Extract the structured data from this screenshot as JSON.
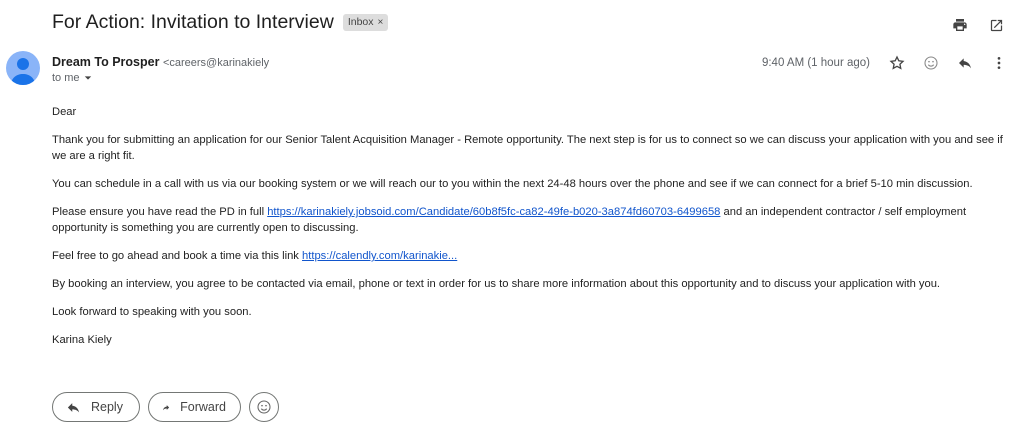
{
  "email": {
    "subject": "For Action: Invitation to Interview",
    "label": "Inbox",
    "label_close": "×",
    "sender_name": "Dream To Prosper",
    "sender_email": "<careers@karinakiely",
    "to_line": "to me",
    "time": "9:40 AM (1 hour ago)"
  },
  "icons": {
    "print": "print-icon",
    "open_new": "open-in-new-window-icon",
    "star": "star-icon",
    "emoji": "emoji-icon",
    "reply": "reply-icon",
    "more": "more-vert-icon"
  },
  "body": {
    "greeting": "Dear",
    "p1": "Thank you for submitting an application for our Senior Talent Acquisition Manager - Remote opportunity. The next step is for us to connect so we can discuss your application with you and see if we are a right fit.",
    "p2": "You can schedule in a call with us via our booking system or we will reach our to you within the next 24-48 hours over the phone and see if we can connect for a brief 5-10 min discussion.",
    "p3_before": "Please ensure you have read the PD in full ",
    "p3_link": "https://karinakiely.jobsoid.com/Candidate/60b8f5fc-ca82-49fe-b020-3a874fd60703-6499658",
    "p3_after": " and an independent contractor / self employment opportunity is something you are currently open to discussing.",
    "p4_before": "Feel free to go ahead and book a time via this link ",
    "p4_link": "https://calendly.com/karinakie...",
    "p5": "By booking an interview, you agree to be contacted via email, phone or text in order for us to share more information about this opportunity and to discuss your application with you.",
    "p6": "Look forward to speaking with you soon.",
    "signature": "Karina Kiely"
  },
  "actions": {
    "reply_label": "Reply",
    "forward_label": "Forward"
  },
  "colors": {
    "link": "#1155cc",
    "avatar_bg": "#8ab4f8",
    "avatar_fg": "#1a73e8"
  }
}
